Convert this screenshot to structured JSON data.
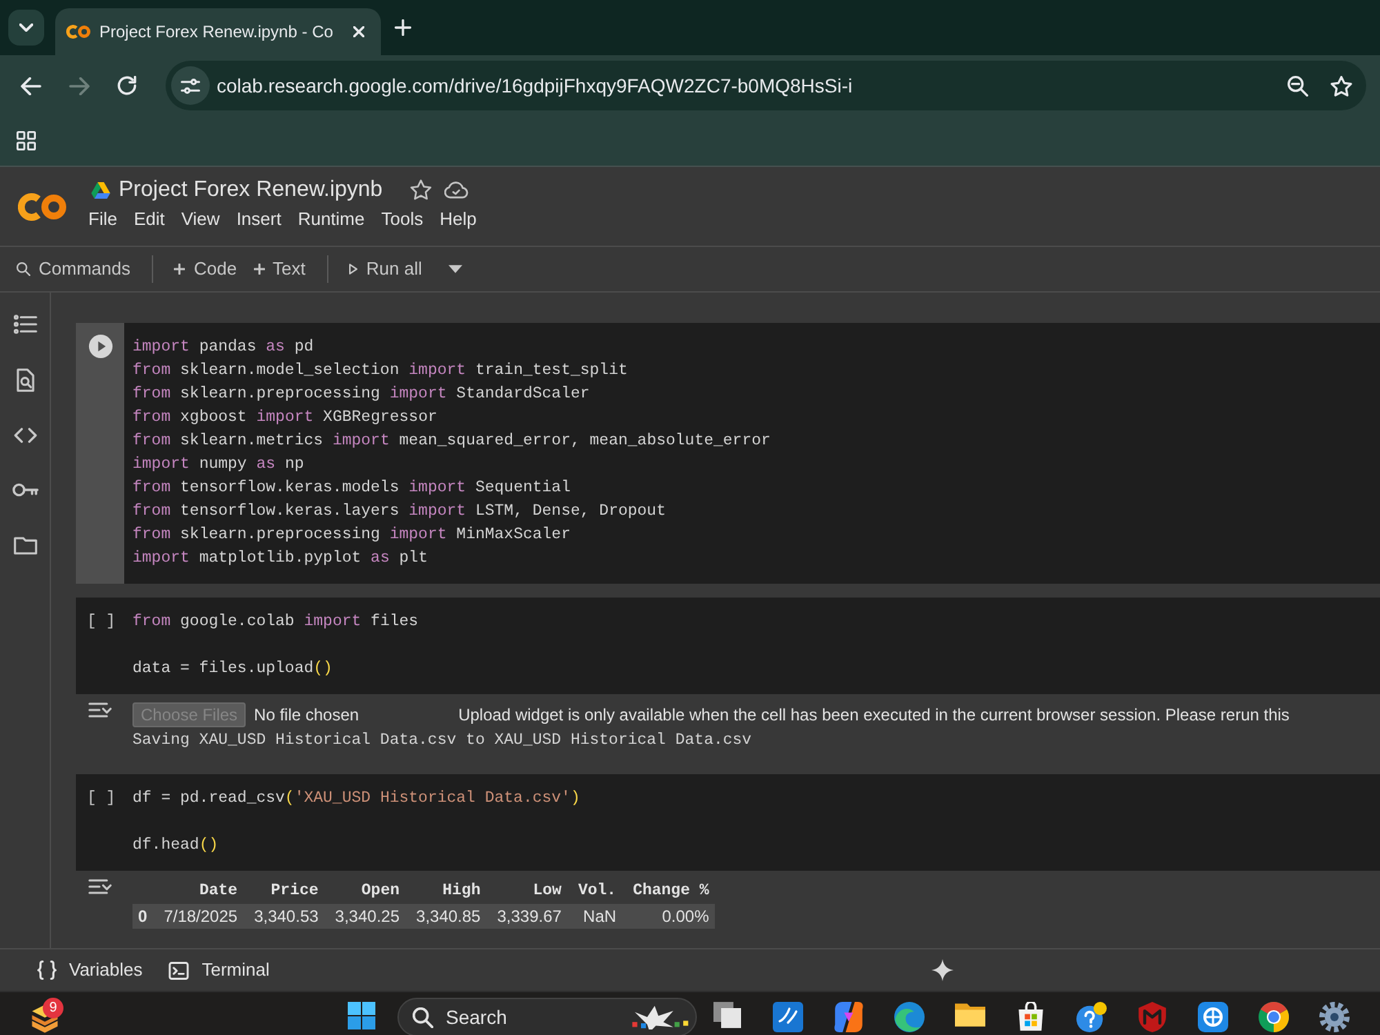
{
  "browser": {
    "tab_title": "Project Forex Renew.ipynb - Co",
    "nav_buttons": [
      {
        "kind": "back",
        "disabled": false
      },
      {
        "kind": "forward",
        "disabled": true
      },
      {
        "kind": "reload",
        "disabled": false
      }
    ],
    "url": "colab.research.google.com/drive/16gdpijFhxqy9FAQW2ZC7-b0MQ8HsSi-i"
  },
  "notebook": {
    "title": "Project Forex Renew.ipynb",
    "menu": [
      "File",
      "Edit",
      "View",
      "Insert",
      "Runtime",
      "Tools",
      "Help"
    ],
    "toolbar": [
      {
        "kind": "search",
        "label": "Commands"
      },
      {
        "kind": "add",
        "label": "Code"
      },
      {
        "kind": "add",
        "label": "Text"
      },
      {
        "kind": "run",
        "label": "Run all"
      }
    ]
  },
  "cells": [
    {
      "selected": true,
      "blocks": [
        [
          [
            {
              "kind": "keyword",
              "text": "import"
            },
            {
              "kind": "plain",
              "text": " pandas "
            },
            {
              "kind": "keyword",
              "text": "as"
            },
            {
              "kind": "plain",
              "text": " pd"
            }
          ],
          [
            {
              "kind": "keyword",
              "text": "from"
            },
            {
              "kind": "plain",
              "text": " sklearn.model_selection "
            },
            {
              "kind": "keyword",
              "text": "import"
            },
            {
              "kind": "plain",
              "text": " train_test_split"
            }
          ],
          [
            {
              "kind": "keyword",
              "text": "from"
            },
            {
              "kind": "plain",
              "text": " sklearn.preprocessing "
            },
            {
              "kind": "keyword",
              "text": "import"
            },
            {
              "kind": "plain",
              "text": " StandardScaler"
            }
          ],
          [
            {
              "kind": "keyword",
              "text": "from"
            },
            {
              "kind": "plain",
              "text": " xgboost "
            },
            {
              "kind": "keyword",
              "text": "import"
            },
            {
              "kind": "plain",
              "text": " XGBRegressor"
            }
          ],
          [
            {
              "kind": "keyword",
              "text": "from"
            },
            {
              "kind": "plain",
              "text": " sklearn.metrics "
            },
            {
              "kind": "keyword",
              "text": "import"
            },
            {
              "kind": "plain",
              "text": " mean_squared_error, mean_absolute_error"
            }
          ],
          [
            {
              "kind": "keyword",
              "text": "import"
            },
            {
              "kind": "plain",
              "text": " numpy "
            },
            {
              "kind": "keyword",
              "text": "as"
            },
            {
              "kind": "plain",
              "text": " np"
            }
          ],
          [
            {
              "kind": "keyword",
              "text": "from"
            },
            {
              "kind": "plain",
              "text": " tensorflow.keras.models "
            },
            {
              "kind": "keyword",
              "text": "import"
            },
            {
              "kind": "plain",
              "text": " Sequential"
            }
          ],
          [
            {
              "kind": "keyword",
              "text": "from"
            },
            {
              "kind": "plain",
              "text": " tensorflow.keras.layers "
            },
            {
              "kind": "keyword",
              "text": "import"
            },
            {
              "kind": "plain",
              "text": " LSTM, Dense, Dropout"
            }
          ],
          [
            {
              "kind": "keyword",
              "text": "from"
            },
            {
              "kind": "plain",
              "text": " sklearn.preprocessing "
            },
            {
              "kind": "keyword",
              "text": "import"
            },
            {
              "kind": "plain",
              "text": " MinMaxScaler"
            }
          ],
          [
            {
              "kind": "keyword",
              "text": "import"
            },
            {
              "kind": "plain",
              "text": " matplotlib.pyplot "
            },
            {
              "kind": "keyword",
              "text": "as"
            },
            {
              "kind": "plain",
              "text": " plt"
            }
          ]
        ]
      ]
    },
    {
      "selected": false,
      "prompt": "[ ]",
      "blocks": [
        [
          [
            {
              "kind": "keyword",
              "text": "from"
            },
            {
              "kind": "plain",
              "text": " google.colab "
            },
            {
              "kind": "keyword",
              "text": "import"
            },
            {
              "kind": "plain",
              "text": " files"
            }
          ]
        ],
        [
          [
            {
              "kind": "plain",
              "text": "data = files.upload"
            },
            {
              "kind": "bracket",
              "text": "()"
            }
          ]
        ]
      ],
      "output": {
        "kind": "upload",
        "button": {
          "label": "Choose Files",
          "disabled": true
        },
        "file_status": "No file chosen",
        "message": "Upload widget is only available when the cell has been executed in the current browser session. Please rerun this",
        "log": "Saving XAU_USD Historical Data.csv to XAU_USD Historical Data.csv"
      }
    },
    {
      "selected": false,
      "prompt": "[ ]",
      "blocks": [
        [
          [
            {
              "kind": "plain",
              "text": "df = pd.read_csv"
            },
            {
              "kind": "bracket",
              "text": "("
            },
            {
              "kind": "string",
              "text": "'XAU_USD Historical Data.csv'"
            },
            {
              "kind": "bracket",
              "text": ")"
            }
          ]
        ],
        [
          [
            {
              "kind": "plain",
              "text": "df.head"
            },
            {
              "kind": "bracket",
              "text": "()"
            }
          ]
        ]
      ],
      "output": {
        "kind": "table",
        "columns": [
          "Date",
          "Price",
          "Open",
          "High",
          "Low",
          "Vol.",
          "Change %"
        ],
        "rows": [
          {
            "index": "0",
            "cells": [
              "7/18/2025",
              "3,340.53",
              "3,340.25",
              "3,340.85",
              "3,339.67",
              "NaN",
              "0.00%"
            ]
          }
        ]
      }
    }
  ],
  "status_bar": {
    "items": [
      {
        "kind": "variables",
        "label": "Variables"
      },
      {
        "kind": "terminal",
        "label": "Terminal"
      }
    ]
  },
  "taskbar": {
    "notification_count": "9",
    "search_label": "Search"
  }
}
